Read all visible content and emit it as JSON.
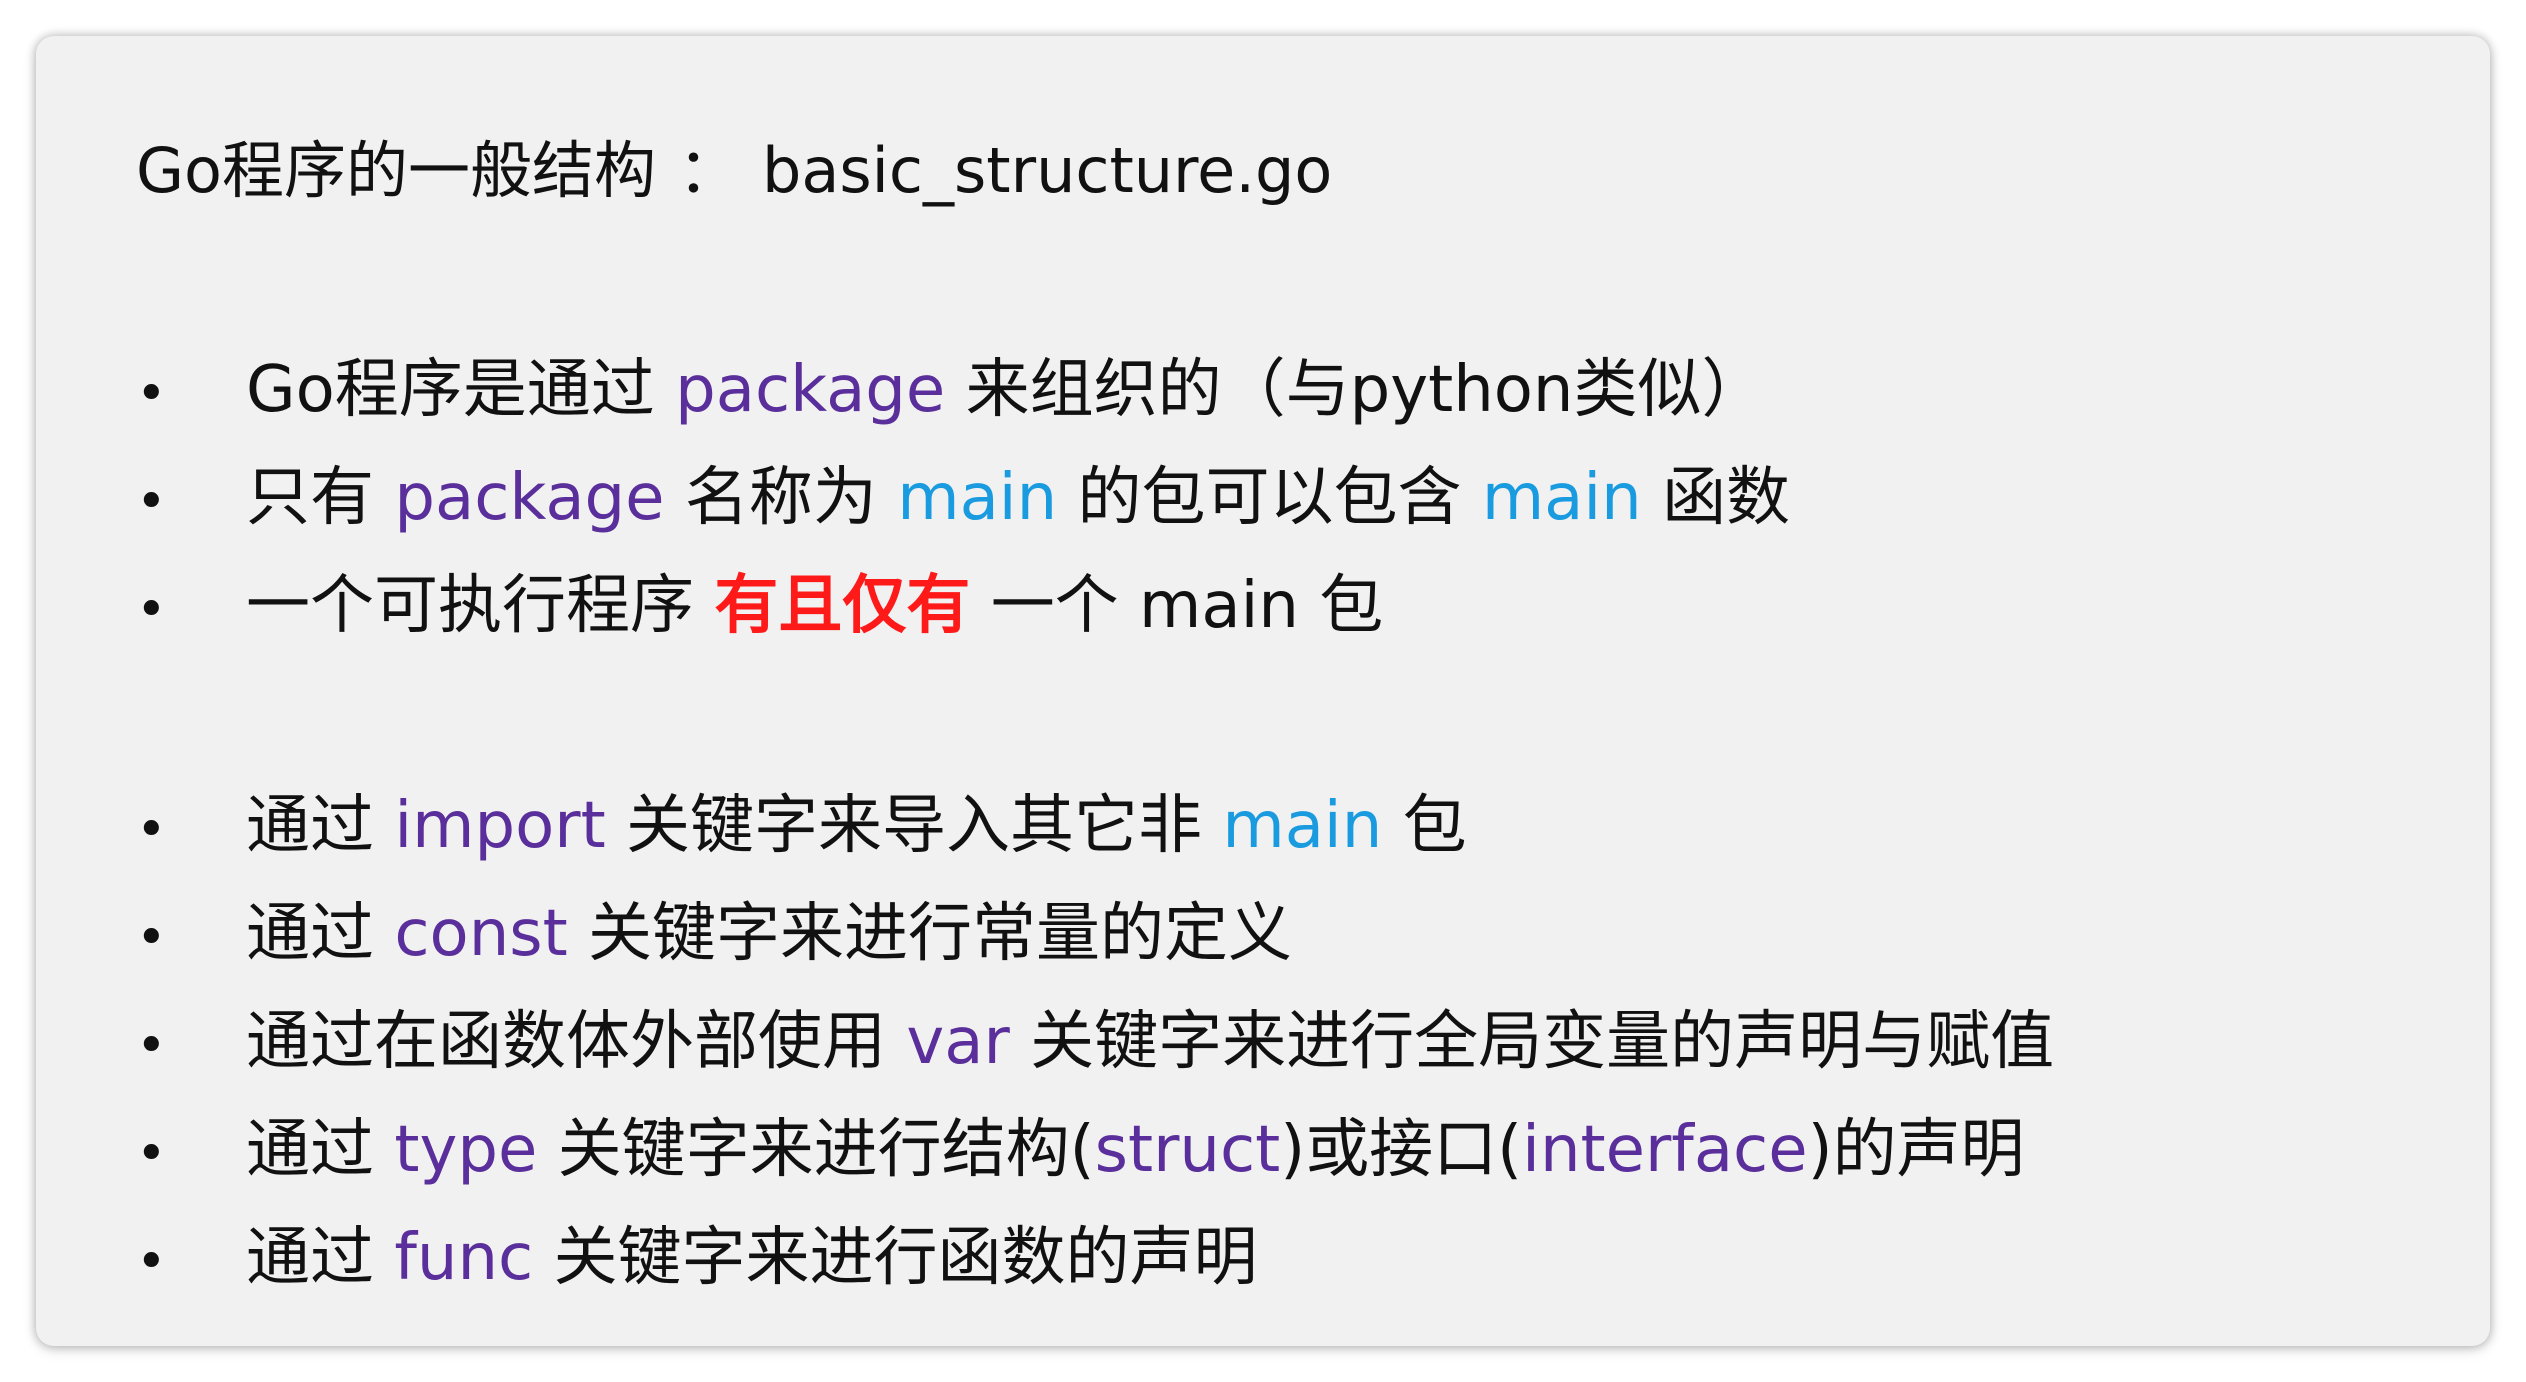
{
  "title": {
    "heading": "Go程序的一般结构",
    "separator": "：",
    "filename": "basic_structure.go"
  },
  "colors": {
    "keyword_purple": "#5a2f9b",
    "keyword_blue": "#1a9be0",
    "emphasis_red": "#ff1a1a",
    "text": "#111111",
    "panel_background": "#f1f1f1"
  },
  "bullets": [
    {
      "marker": "•",
      "s1": "Go程序是通过 ",
      "k1": "package",
      "s2": " 来组织的（与python类似）"
    },
    {
      "marker": "•",
      "s1": "只有 ",
      "k1": "package",
      "s2": " 名称为 ",
      "k2": "main",
      "s3": " 的包可以包含 ",
      "k3": "main",
      "s4": " 函数"
    },
    {
      "marker": "•",
      "s1": "一个可执行程序 ",
      "k1": "有且仅有",
      "s2": " 一个 main 包"
    },
    {
      "marker": "•",
      "s1": "通过 ",
      "k1": "import",
      "s2": " 关键字来导入其它非 ",
      "k2": "main",
      "s3": " 包"
    },
    {
      "marker": "•",
      "s1": "通过 ",
      "k1": "const",
      "s2": " 关键字来进行常量的定义"
    },
    {
      "marker": "•",
      "s1": "通过在函数体外部使用 ",
      "k1": "var",
      "s2": " 关键字来进行全局变量的声明与赋值"
    },
    {
      "marker": "•",
      "s1": "通过 ",
      "k1": "type",
      "s2": " 关键字来进行结构(",
      "k2": "struct",
      "s3": ")或接口(",
      "k3": "interface",
      "s4": ")的声明"
    },
    {
      "marker": "•",
      "s1": "通过 ",
      "k1": "func",
      "s2": " 关键字来进行函数的声明"
    }
  ]
}
